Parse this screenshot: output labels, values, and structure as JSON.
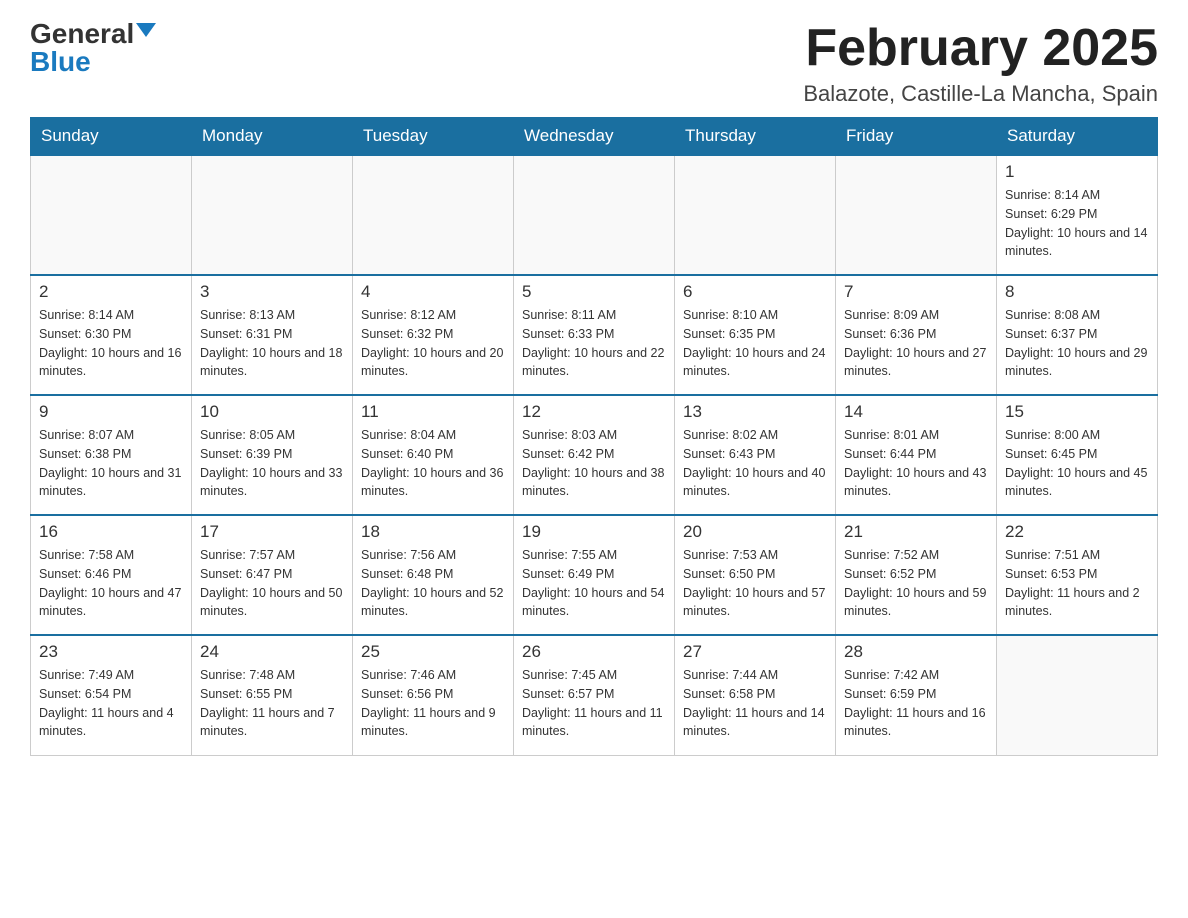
{
  "header": {
    "logo_general": "General",
    "logo_blue": "Blue",
    "month_title": "February 2025",
    "location": "Balazote, Castille-La Mancha, Spain"
  },
  "weekdays": [
    "Sunday",
    "Monday",
    "Tuesday",
    "Wednesday",
    "Thursday",
    "Friday",
    "Saturday"
  ],
  "weeks": [
    [
      {
        "day": "",
        "sunrise": "",
        "sunset": "",
        "daylight": ""
      },
      {
        "day": "",
        "sunrise": "",
        "sunset": "",
        "daylight": ""
      },
      {
        "day": "",
        "sunrise": "",
        "sunset": "",
        "daylight": ""
      },
      {
        "day": "",
        "sunrise": "",
        "sunset": "",
        "daylight": ""
      },
      {
        "day": "",
        "sunrise": "",
        "sunset": "",
        "daylight": ""
      },
      {
        "day": "",
        "sunrise": "",
        "sunset": "",
        "daylight": ""
      },
      {
        "day": "1",
        "sunrise": "Sunrise: 8:14 AM",
        "sunset": "Sunset: 6:29 PM",
        "daylight": "Daylight: 10 hours and 14 minutes."
      }
    ],
    [
      {
        "day": "2",
        "sunrise": "Sunrise: 8:14 AM",
        "sunset": "Sunset: 6:30 PM",
        "daylight": "Daylight: 10 hours and 16 minutes."
      },
      {
        "day": "3",
        "sunrise": "Sunrise: 8:13 AM",
        "sunset": "Sunset: 6:31 PM",
        "daylight": "Daylight: 10 hours and 18 minutes."
      },
      {
        "day": "4",
        "sunrise": "Sunrise: 8:12 AM",
        "sunset": "Sunset: 6:32 PM",
        "daylight": "Daylight: 10 hours and 20 minutes."
      },
      {
        "day": "5",
        "sunrise": "Sunrise: 8:11 AM",
        "sunset": "Sunset: 6:33 PM",
        "daylight": "Daylight: 10 hours and 22 minutes."
      },
      {
        "day": "6",
        "sunrise": "Sunrise: 8:10 AM",
        "sunset": "Sunset: 6:35 PM",
        "daylight": "Daylight: 10 hours and 24 minutes."
      },
      {
        "day": "7",
        "sunrise": "Sunrise: 8:09 AM",
        "sunset": "Sunset: 6:36 PM",
        "daylight": "Daylight: 10 hours and 27 minutes."
      },
      {
        "day": "8",
        "sunrise": "Sunrise: 8:08 AM",
        "sunset": "Sunset: 6:37 PM",
        "daylight": "Daylight: 10 hours and 29 minutes."
      }
    ],
    [
      {
        "day": "9",
        "sunrise": "Sunrise: 8:07 AM",
        "sunset": "Sunset: 6:38 PM",
        "daylight": "Daylight: 10 hours and 31 minutes."
      },
      {
        "day": "10",
        "sunrise": "Sunrise: 8:05 AM",
        "sunset": "Sunset: 6:39 PM",
        "daylight": "Daylight: 10 hours and 33 minutes."
      },
      {
        "day": "11",
        "sunrise": "Sunrise: 8:04 AM",
        "sunset": "Sunset: 6:40 PM",
        "daylight": "Daylight: 10 hours and 36 minutes."
      },
      {
        "day": "12",
        "sunrise": "Sunrise: 8:03 AM",
        "sunset": "Sunset: 6:42 PM",
        "daylight": "Daylight: 10 hours and 38 minutes."
      },
      {
        "day": "13",
        "sunrise": "Sunrise: 8:02 AM",
        "sunset": "Sunset: 6:43 PM",
        "daylight": "Daylight: 10 hours and 40 minutes."
      },
      {
        "day": "14",
        "sunrise": "Sunrise: 8:01 AM",
        "sunset": "Sunset: 6:44 PM",
        "daylight": "Daylight: 10 hours and 43 minutes."
      },
      {
        "day": "15",
        "sunrise": "Sunrise: 8:00 AM",
        "sunset": "Sunset: 6:45 PM",
        "daylight": "Daylight: 10 hours and 45 minutes."
      }
    ],
    [
      {
        "day": "16",
        "sunrise": "Sunrise: 7:58 AM",
        "sunset": "Sunset: 6:46 PM",
        "daylight": "Daylight: 10 hours and 47 minutes."
      },
      {
        "day": "17",
        "sunrise": "Sunrise: 7:57 AM",
        "sunset": "Sunset: 6:47 PM",
        "daylight": "Daylight: 10 hours and 50 minutes."
      },
      {
        "day": "18",
        "sunrise": "Sunrise: 7:56 AM",
        "sunset": "Sunset: 6:48 PM",
        "daylight": "Daylight: 10 hours and 52 minutes."
      },
      {
        "day": "19",
        "sunrise": "Sunrise: 7:55 AM",
        "sunset": "Sunset: 6:49 PM",
        "daylight": "Daylight: 10 hours and 54 minutes."
      },
      {
        "day": "20",
        "sunrise": "Sunrise: 7:53 AM",
        "sunset": "Sunset: 6:50 PM",
        "daylight": "Daylight: 10 hours and 57 minutes."
      },
      {
        "day": "21",
        "sunrise": "Sunrise: 7:52 AM",
        "sunset": "Sunset: 6:52 PM",
        "daylight": "Daylight: 10 hours and 59 minutes."
      },
      {
        "day": "22",
        "sunrise": "Sunrise: 7:51 AM",
        "sunset": "Sunset: 6:53 PM",
        "daylight": "Daylight: 11 hours and 2 minutes."
      }
    ],
    [
      {
        "day": "23",
        "sunrise": "Sunrise: 7:49 AM",
        "sunset": "Sunset: 6:54 PM",
        "daylight": "Daylight: 11 hours and 4 minutes."
      },
      {
        "day": "24",
        "sunrise": "Sunrise: 7:48 AM",
        "sunset": "Sunset: 6:55 PM",
        "daylight": "Daylight: 11 hours and 7 minutes."
      },
      {
        "day": "25",
        "sunrise": "Sunrise: 7:46 AM",
        "sunset": "Sunset: 6:56 PM",
        "daylight": "Daylight: 11 hours and 9 minutes."
      },
      {
        "day": "26",
        "sunrise": "Sunrise: 7:45 AM",
        "sunset": "Sunset: 6:57 PM",
        "daylight": "Daylight: 11 hours and 11 minutes."
      },
      {
        "day": "27",
        "sunrise": "Sunrise: 7:44 AM",
        "sunset": "Sunset: 6:58 PM",
        "daylight": "Daylight: 11 hours and 14 minutes."
      },
      {
        "day": "28",
        "sunrise": "Sunrise: 7:42 AM",
        "sunset": "Sunset: 6:59 PM",
        "daylight": "Daylight: 11 hours and 16 minutes."
      },
      {
        "day": "",
        "sunrise": "",
        "sunset": "",
        "daylight": ""
      }
    ]
  ]
}
